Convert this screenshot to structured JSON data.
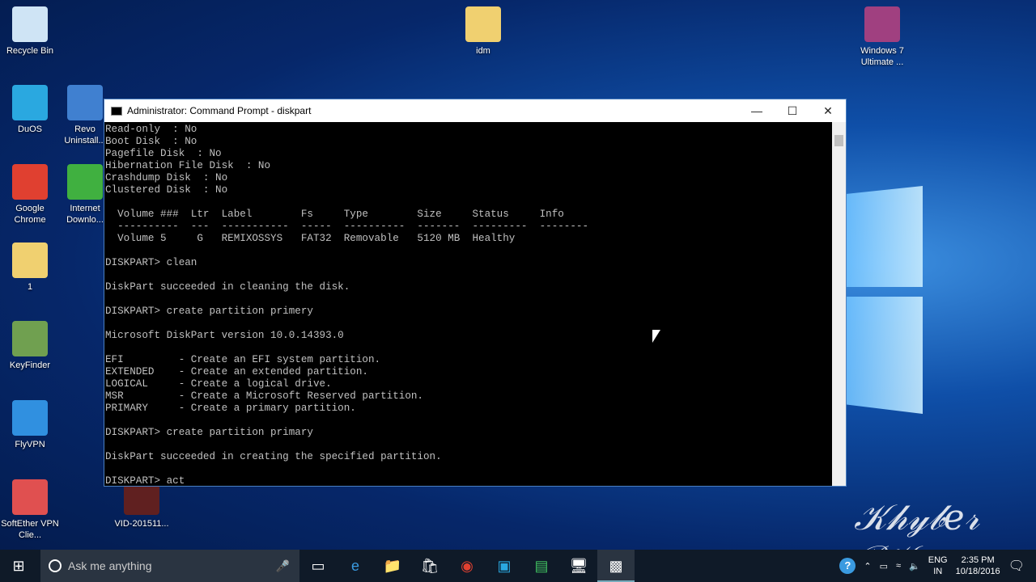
{
  "desktop": {
    "icons": [
      {
        "label": "Recycle Bin",
        "color": "#cfe4f5"
      },
      {
        "label": "DuOS",
        "color": "#2aa8e0"
      },
      {
        "label": "Google Chrome",
        "color": "#e04030"
      },
      {
        "label": "1",
        "color": "#f0d070"
      },
      {
        "label": "KeyFinder",
        "color": "#70a050"
      },
      {
        "label": "FlyVPN",
        "color": "#3090e0"
      },
      {
        "label": "SoftEther VPN Clie...",
        "color": "#e05050"
      },
      {
        "label": "Revo Uninstall...",
        "color": "#4080d0"
      },
      {
        "label": "Internet Downlo...",
        "color": "#40b040"
      },
      {
        "label": "VID-201511...",
        "color": "#602020"
      },
      {
        "label": "idm",
        "color": "#f0d070"
      },
      {
        "label": "Windows 7 Ultimate ...",
        "color": "#a04080"
      }
    ]
  },
  "window": {
    "title": "Administrator: Command Prompt - diskpart",
    "console": "Read-only  : No\nBoot Disk  : No\nPagefile Disk  : No\nHibernation File Disk  : No\nCrashdump Disk  : No\nClustered Disk  : No\n\n  Volume ###  Ltr  Label        Fs     Type        Size     Status     Info\n  ----------  ---  -----------  -----  ----------  -------  ---------  --------\n  Volume 5     G   REMIXOSSYS   FAT32  Removable   5120 MB  Healthy\n\nDISKPART> clean\n\nDiskPart succeeded in cleaning the disk.\n\nDISKPART> create partition primery\n\nMicrosoft DiskPart version 10.0.14393.0\n\nEFI         - Create an EFI system partition.\nEXTENDED    - Create an extended partition.\nLOGICAL     - Create a logical drive.\nMSR         - Create a Microsoft Reserved partition.\nPRIMARY     - Create a primary partition.\n\nDISKPART> create partition primary\n\nDiskPart succeeded in creating the specified partition.\n\nDISKPART> act"
  },
  "taskbar": {
    "search_placeholder": "Ask me anything",
    "lang": "ENG",
    "region": "IN",
    "time": "2:35 PM",
    "date": "10/18/2016"
  },
  "watermark": "Khyber PK"
}
